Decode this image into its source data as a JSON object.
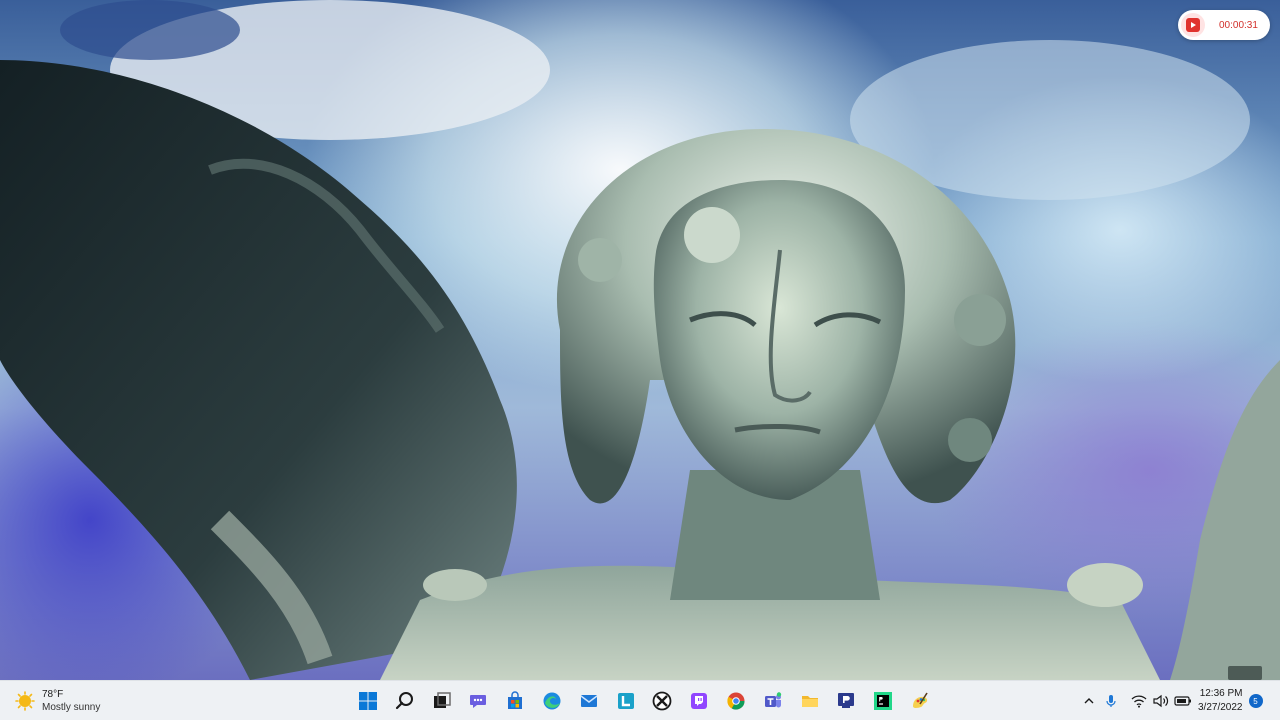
{
  "recorder": {
    "time": "00:00:31"
  },
  "weather": {
    "temperature": "78°F",
    "condition": "Mostly sunny",
    "icon": "sun-icon"
  },
  "taskbar": {
    "icons": [
      {
        "name": "start-button",
        "icon": "windows-logo-icon"
      },
      {
        "name": "search-button",
        "icon": "search-icon"
      },
      {
        "name": "task-view-button",
        "icon": "task-view-icon"
      },
      {
        "name": "chat-button",
        "icon": "teams-chat-icon"
      },
      {
        "name": "microsoft-store-button",
        "icon": "store-icon"
      },
      {
        "name": "edge-button",
        "icon": "edge-icon"
      },
      {
        "name": "mail-button",
        "icon": "mail-icon"
      },
      {
        "name": "l-app-button",
        "icon": "l-app-icon"
      },
      {
        "name": "xbox-button",
        "icon": "xbox-icon"
      },
      {
        "name": "twitch-button",
        "icon": "twitch-icon"
      },
      {
        "name": "chrome-button",
        "icon": "chrome-icon"
      },
      {
        "name": "teams-button",
        "icon": "teams-icon"
      },
      {
        "name": "file-explorer-button",
        "icon": "folder-icon"
      },
      {
        "name": "app-p-button",
        "icon": "presentation-icon"
      },
      {
        "name": "pycharm-button",
        "icon": "pycharm-icon"
      },
      {
        "name": "paint-button",
        "icon": "paint-icon"
      }
    ]
  },
  "tray": {
    "clock_time": "12:36 PM",
    "clock_date": "3/27/2022",
    "notification_count": "5"
  },
  "colors": {
    "taskbar_bg": "#eef1f4",
    "accent": "#1067c9",
    "recorder_red": "#e0332e"
  }
}
